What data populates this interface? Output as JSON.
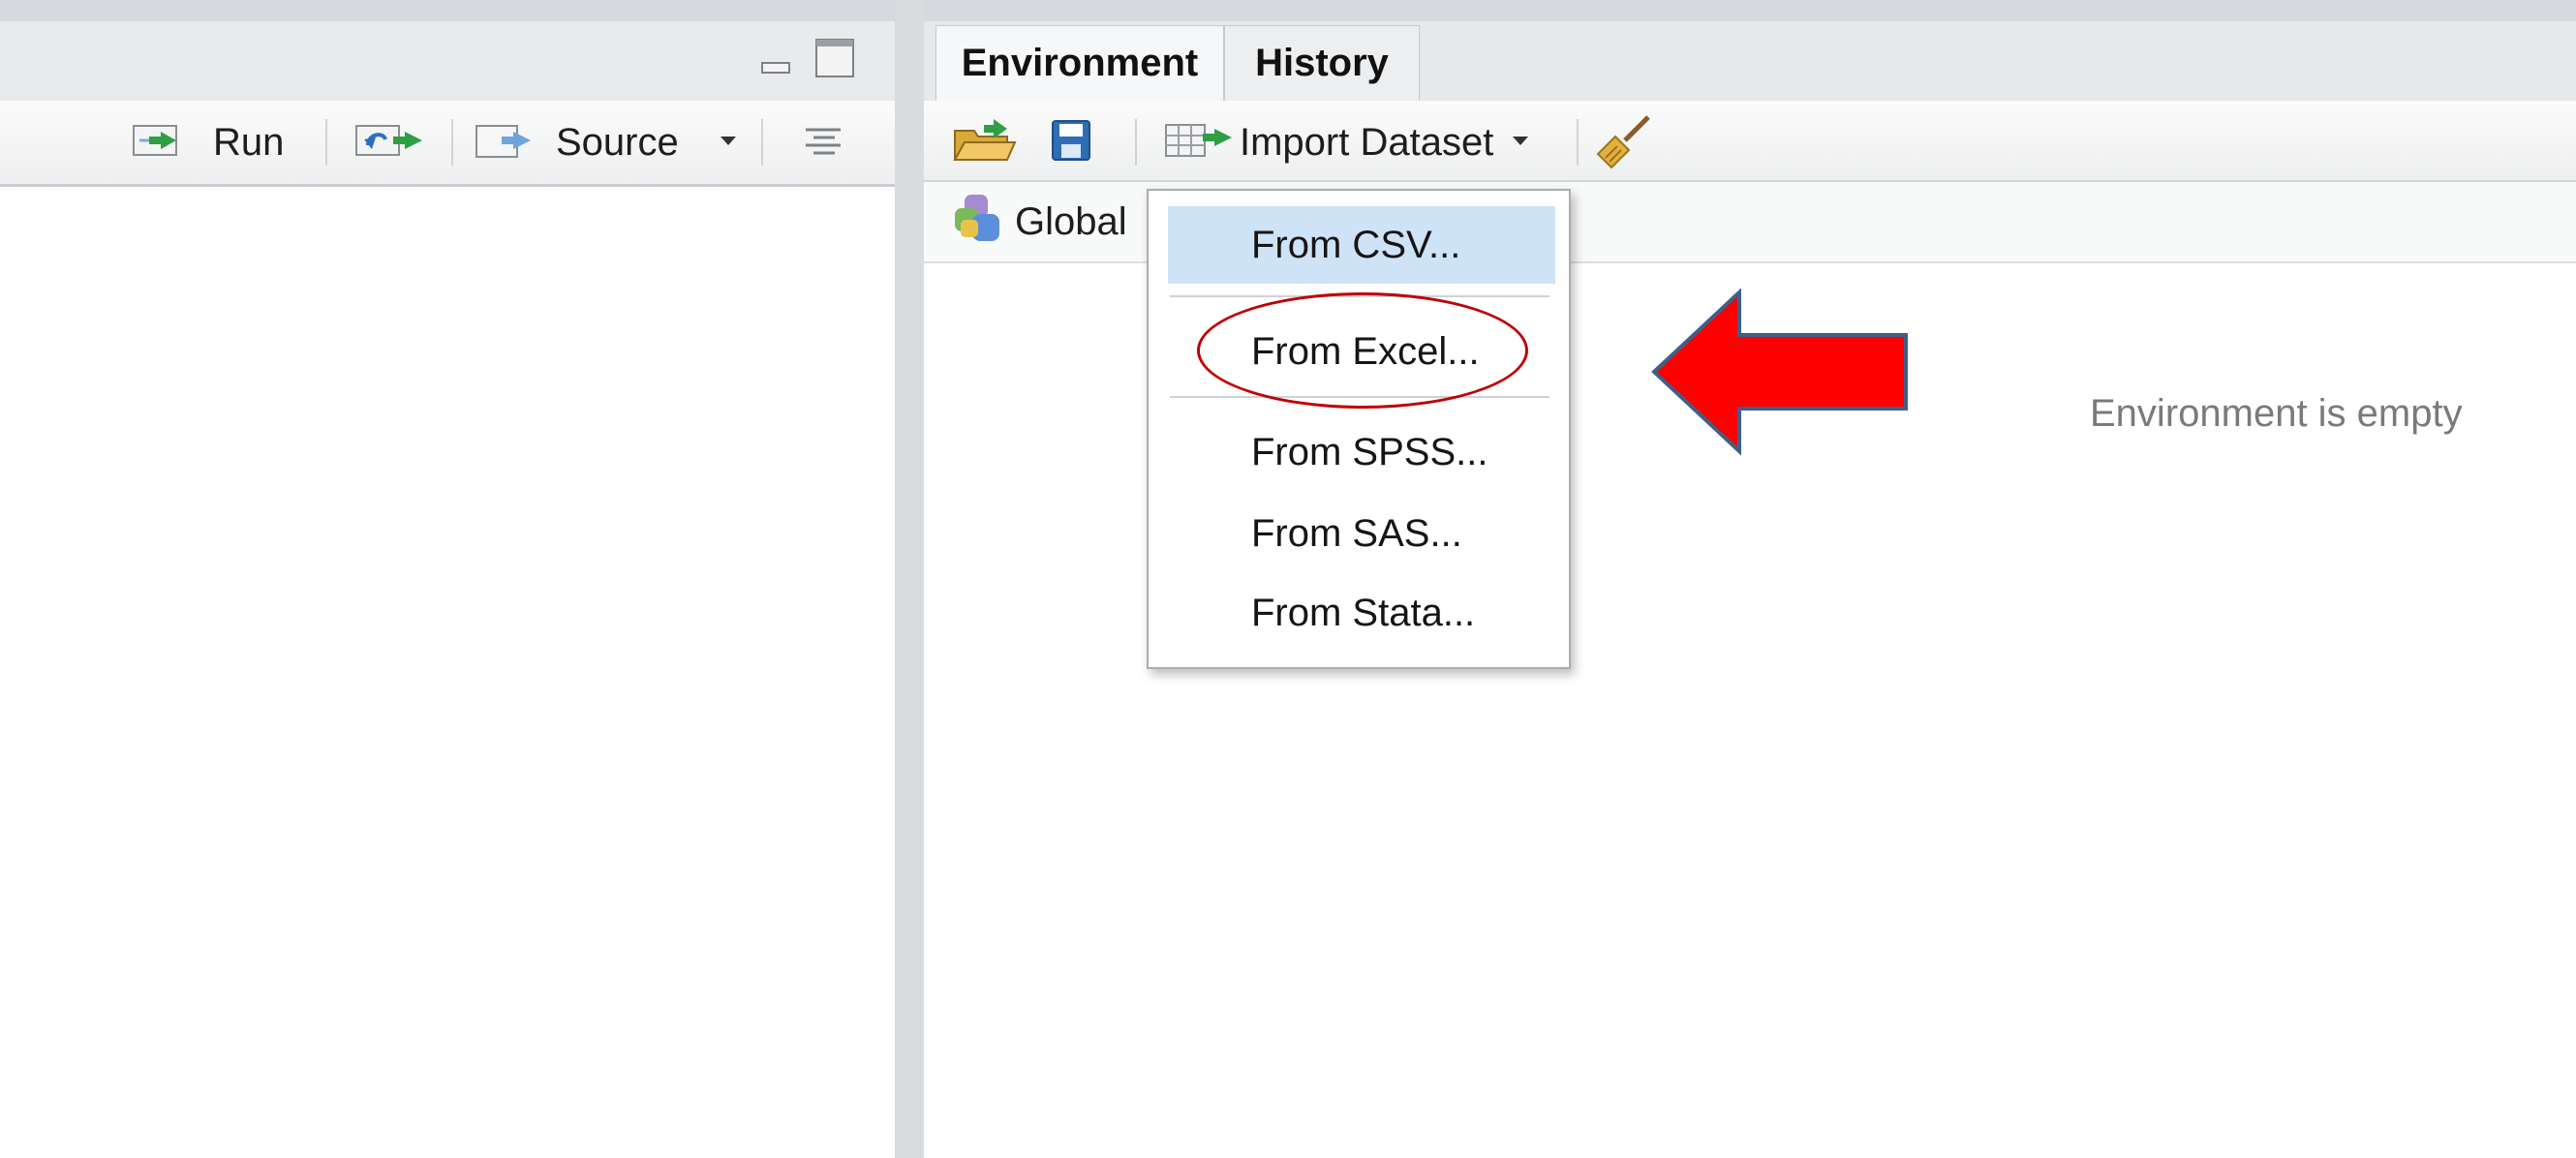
{
  "source_toolbar": {
    "run_label": "Run",
    "source_label": "Source"
  },
  "tabs": [
    {
      "label": "Environment"
    },
    {
      "label": "History"
    }
  ],
  "env_toolbar": {
    "import_label": "Import Dataset"
  },
  "env_scope": {
    "label": "Global"
  },
  "import_menu": {
    "items": [
      {
        "label": "From CSV..."
      },
      {
        "label": "From Excel..."
      },
      {
        "label": "From SPSS..."
      },
      {
        "label": "From SAS..."
      },
      {
        "label": "From Stata..."
      }
    ],
    "highlighted": "From CSV...",
    "circled": "From Excel..."
  },
  "env_panel": {
    "empty_message": "Environment is empty"
  },
  "colors": {
    "menu_highlight": "#cfe3f6",
    "annotation_red": "#ff0000",
    "ellipse_red": "#c00000"
  },
  "icons": [
    "minimize-icon",
    "maximize-icon",
    "run-icon",
    "rerun-icon",
    "source-icon",
    "dropdown-caret-icon",
    "outline-icon",
    "open-folder-icon",
    "save-icon",
    "import-dataset-icon",
    "broom-icon",
    "global-environment-icon"
  ]
}
